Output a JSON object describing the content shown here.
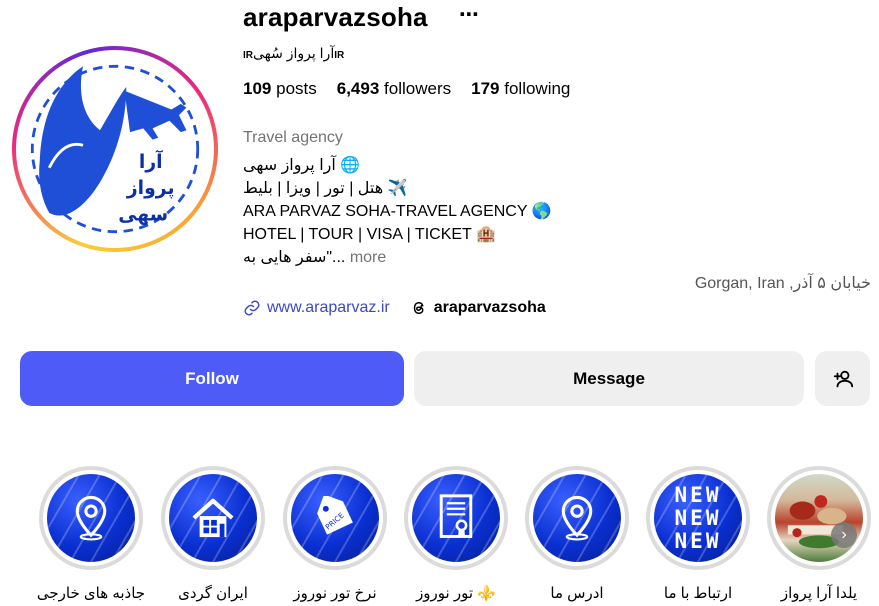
{
  "profile": {
    "username": "araparvazsoha",
    "more_icon": "⋯",
    "handle_ir_left": "IR",
    "handle_name": "آرا پرواز سُهی",
    "handle_ir_right": "IR",
    "stats": {
      "posts_count": "109",
      "posts_label": "posts",
      "followers_count": "6,493",
      "followers_label": "followers",
      "following_count": "179",
      "following_label": "following"
    },
    "category": "Travel agency",
    "bio": {
      "line1": "آرا پرواز سهی 🌐",
      "line2": "هتل | تور | ویزا | بلیط ✈️",
      "line3": "ARA PARVAZ SOHA-TRAVEL AGENCY 🌎",
      "line4": "HOTEL | TOUR | VISA | TICKET 🏨",
      "line5": "سفر هایی به\"...",
      "more": "more"
    },
    "address": "Gorgan, Iran ,خیابان ۵ آذر",
    "website": "www.araparvaz.ir",
    "threads": "araparvazsoha",
    "avatar_text": {
      "line1": "آرا",
      "line2": "پرواز",
      "line3": "سهی"
    }
  },
  "actions": {
    "follow": "Follow",
    "message": "Message"
  },
  "highlights": [
    {
      "label": "جاذبه های خارجی",
      "icon": "map-pin-icon"
    },
    {
      "label": "ایران گردی",
      "icon": "house-icon"
    },
    {
      "label": "نرخ تور نوروز",
      "icon": "price-tag-icon"
    },
    {
      "label": "تور نوروز ⚜️",
      "icon": "certificate-icon"
    },
    {
      "label": "ادرس ما",
      "icon": "map-pin-icon"
    },
    {
      "label": "ارتباط با ما",
      "icon": "new-text"
    },
    {
      "label": "یلدا آرا پرواز",
      "icon": "photo"
    }
  ],
  "new_text": {
    "l1": "NEW",
    "l2": "NEW",
    "l3": "NEW"
  },
  "colors": {
    "follow_bg": "#4f5bf7",
    "message_bg": "#efefef",
    "link": "#3c47c9",
    "muted": "#737373",
    "brand_blue": "#1f4fd6"
  }
}
